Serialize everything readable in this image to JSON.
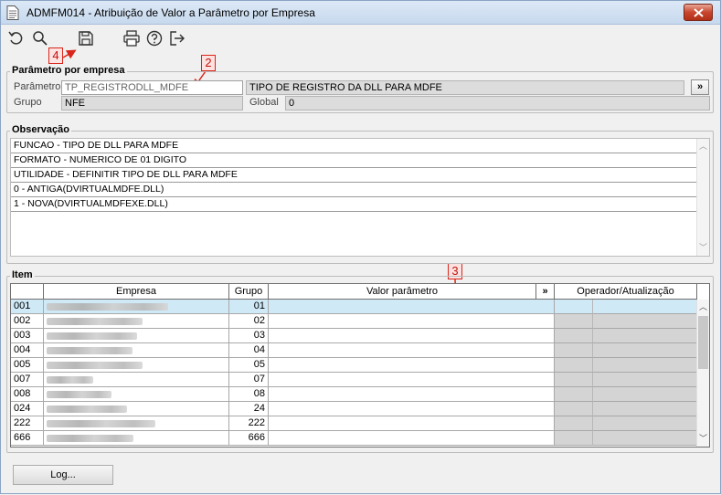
{
  "window": {
    "title": "ADMFM014 - Atribuição de Valor a Parâmetro por Empresa"
  },
  "annotations": [
    "4",
    "2",
    "3"
  ],
  "parametro_group": {
    "legend": "Parâmetro por empresa",
    "parametro_label": "Parâmetro",
    "parametro_value": "TP_REGISTRODLL_MDFE",
    "descricao_value": "TIPO DE REGISTRO DA DLL PARA MDFE",
    "lookup_label": "»",
    "grupo_label": "Grupo",
    "grupo_value": "NFE",
    "global_label": "Global",
    "global_value": "0"
  },
  "observacao": {
    "legend": "Observação",
    "lines": [
      "FUNCAO - TIPO DE DLL PARA MDFE",
      "FORMATO - NUMERICO DE 01 DIGITO",
      "UTILIDADE - DEFINITIR TIPO DE DLL PARA MDFE",
      "0 - ANTIGA(DVIRTUALMDFE.DLL)",
      "1 - NOVA(DVIRTUALMDFEXE.DLL)"
    ]
  },
  "item": {
    "legend": "Item",
    "columns": {
      "empresa": "Empresa",
      "grupo": "Grupo",
      "valor": "Valor parâmetro",
      "expand": "»",
      "operador": "Operador/Atualização"
    },
    "rows": [
      {
        "code": "001",
        "grupo": "01",
        "blur": 0.78
      },
      {
        "code": "002",
        "grupo": "02",
        "blur": 0.62
      },
      {
        "code": "003",
        "grupo": "03",
        "blur": 0.58
      },
      {
        "code": "004",
        "grupo": "04",
        "blur": 0.55
      },
      {
        "code": "005",
        "grupo": "05",
        "blur": 0.62
      },
      {
        "code": "007",
        "grupo": "07",
        "blur": 0.3
      },
      {
        "code": "008",
        "grupo": "08",
        "blur": 0.42
      },
      {
        "code": "024",
        "grupo": "24",
        "blur": 0.52
      },
      {
        "code": "222",
        "grupo": "222",
        "blur": 0.7
      },
      {
        "code": "666",
        "grupo": "666",
        "blur": 0.56
      }
    ]
  },
  "footer": {
    "log_label": "Log..."
  }
}
